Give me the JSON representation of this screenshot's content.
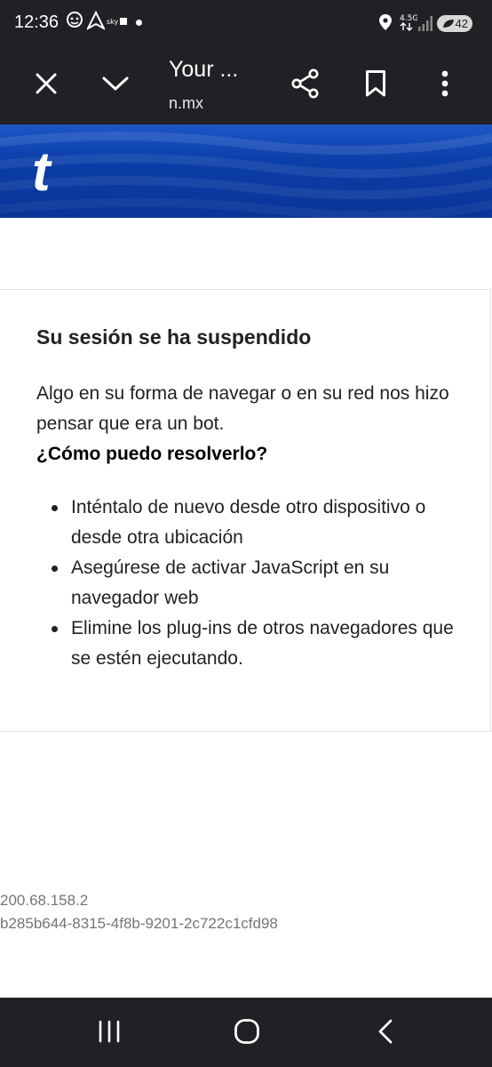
{
  "status_bar": {
    "time": "12:36",
    "network": "4.5G",
    "battery": "42",
    "icons": [
      "waze-icon",
      "arrow-app-icon",
      "sky-icon",
      "notification-dot",
      "location-icon",
      "network-icon",
      "signal-icon",
      "battery-icon"
    ]
  },
  "toolbar": {
    "title": "Your ...",
    "url_faded": "",
    "url": "n.mx",
    "icons": [
      "close-icon",
      "chevron-down-icon",
      "share-icon",
      "bookmark-icon",
      "more-vert-icon"
    ]
  },
  "banner": {
    "logo": "t",
    "color": "#0a3ea8"
  },
  "card": {
    "heading": "Su sesión se ha suspendido",
    "intro": "Algo en su forma de navegar o en su red nos hizo pensar que era un bot.",
    "question": "¿Cómo puedo resolverlo?",
    "items": [
      "Inténtalo de nuevo desde otro dispositivo o desde otra ubicación",
      "Asegúrese de activar JavaScript en su navegador web",
      "Elimine los plug-ins de otros navegadores que se estén ejecutando."
    ]
  },
  "footer": {
    "ip": "200.68.158.2",
    "request_id": "b285b644-8315-4f8b-9201-2c722c1cfd98"
  },
  "navbar": {
    "icons": [
      "recents-icon",
      "home-icon",
      "back-icon"
    ]
  }
}
